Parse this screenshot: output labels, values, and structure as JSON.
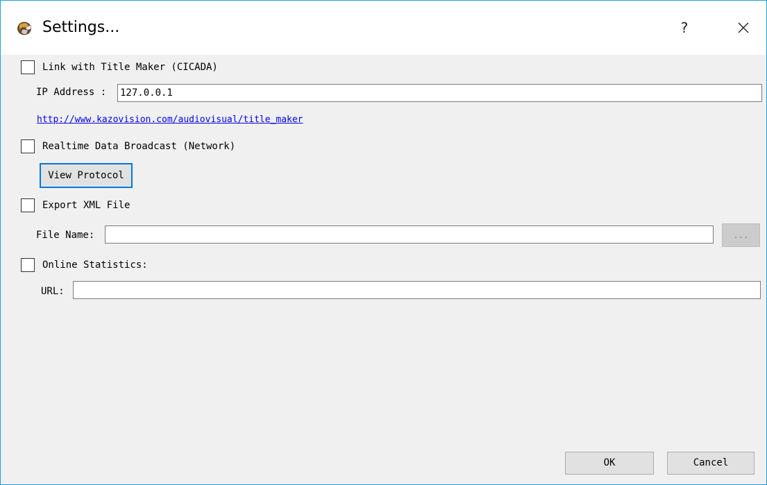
{
  "window": {
    "title": "Settings...",
    "help_label": "?",
    "app_icon": "app-globe-icon",
    "close_icon": "close-icon"
  },
  "link_section": {
    "checkbox_label": "Link with Title Maker (CICADA)",
    "checked": false,
    "ip_label": "IP Address :",
    "ip_value": "127.0.0.1",
    "url_link": "http://www.kazovision.com/audiovisual/title_maker"
  },
  "broadcast_section": {
    "checkbox_label": "Realtime Data Broadcast (Network)",
    "checked": false,
    "view_protocol_label": "View Protocol"
  },
  "export_section": {
    "checkbox_label": "Export XML File",
    "checked": false,
    "file_name_label": "File Name:",
    "file_name_value": "",
    "browse_label": "..."
  },
  "online_section": {
    "checkbox_label": "Online Statistics:",
    "checked": false,
    "url_label": "URL:",
    "url_value": ""
  },
  "footer": {
    "ok_label": "OK",
    "cancel_label": "Cancel"
  }
}
